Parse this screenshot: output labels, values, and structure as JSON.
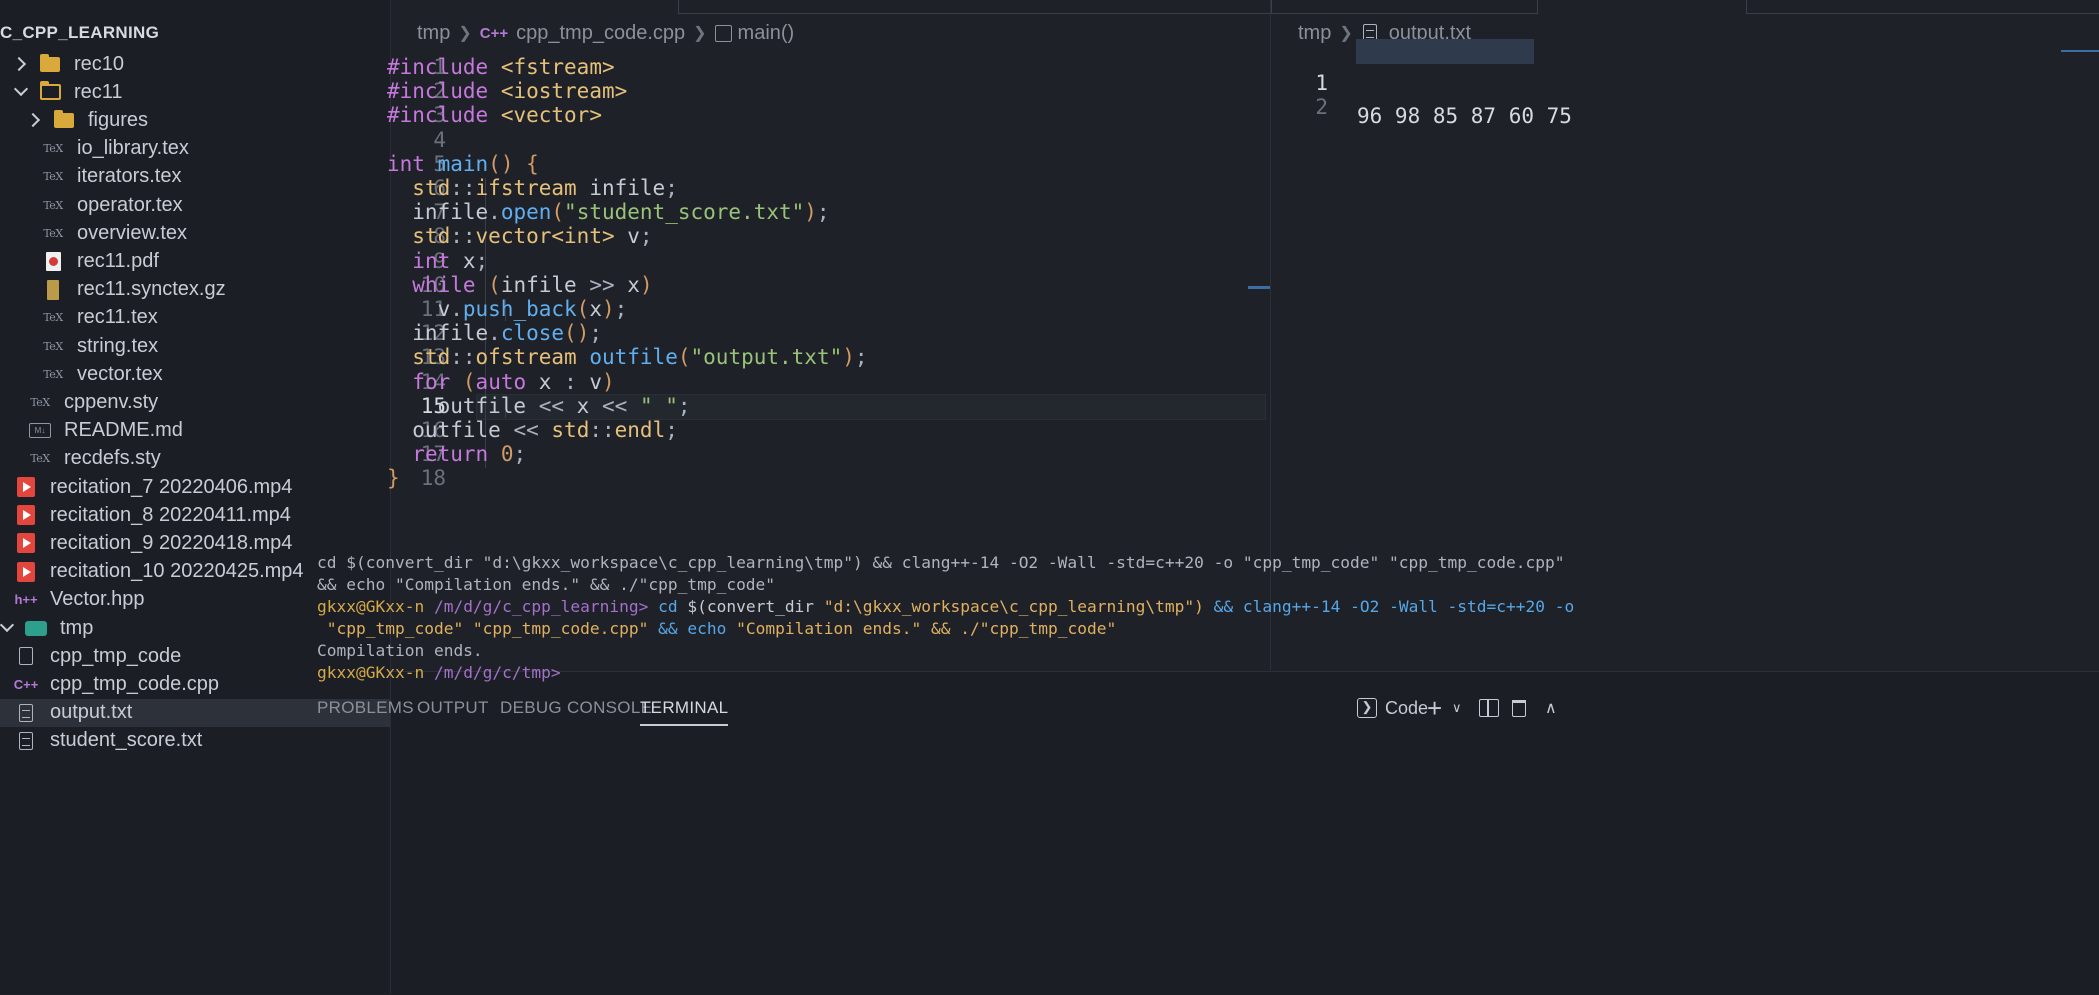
{
  "sidebar": {
    "root_label": "C_CPP_LEARNING",
    "items": [
      {
        "label": "rec10",
        "icon": "folder-icon"
      },
      {
        "label": "rec11",
        "icon": "folder-open-icon"
      },
      {
        "label": "figures",
        "icon": "folder-icon"
      },
      {
        "label": "io_library.tex",
        "icon": "tex-file-icon"
      },
      {
        "label": "iterators.tex",
        "icon": "tex-file-icon"
      },
      {
        "label": "operator.tex",
        "icon": "tex-file-icon"
      },
      {
        "label": "overview.tex",
        "icon": "tex-file-icon"
      },
      {
        "label": "rec11.pdf",
        "icon": "pdf-file-icon"
      },
      {
        "label": "rec11.synctex.gz",
        "icon": "archive-file-icon"
      },
      {
        "label": "rec11.tex",
        "icon": "tex-file-icon"
      },
      {
        "label": "string.tex",
        "icon": "tex-file-icon"
      },
      {
        "label": "vector.tex",
        "icon": "tex-file-icon"
      },
      {
        "label": "cppenv.sty",
        "icon": "tex-file-icon"
      },
      {
        "label": "README.md",
        "icon": "markdown-file-icon"
      },
      {
        "label": "recdefs.sty",
        "icon": "tex-file-icon"
      },
      {
        "label": "recitation_7 20220406.mp4",
        "icon": "video-file-icon"
      },
      {
        "label": "recitation_8 20220411.mp4",
        "icon": "video-file-icon"
      },
      {
        "label": "recitation_9 20220418.mp4",
        "icon": "video-file-icon"
      },
      {
        "label": "recitation_10 20220425.mp4",
        "icon": "video-file-icon"
      },
      {
        "label": "Vector.hpp",
        "icon": "hpp-file-icon"
      },
      {
        "label": "tmp",
        "icon": "folder-open-icon"
      },
      {
        "label": "cpp_tmp_code",
        "icon": "file-icon"
      },
      {
        "label": "cpp_tmp_code.cpp",
        "icon": "cpp-file-icon"
      },
      {
        "label": "output.txt",
        "icon": "text-file-icon"
      },
      {
        "label": "student_score.txt",
        "icon": "text-file-icon"
      }
    ],
    "active_item": "output.txt"
  },
  "editor": {
    "breadcrumb": [
      "tmp",
      "cpp_tmp_code.cpp",
      "main()"
    ],
    "line_numbers": [
      "1",
      "2",
      "3",
      "4",
      "5",
      "6",
      "7",
      "8",
      "9",
      "10",
      "11",
      "12",
      "13",
      "14",
      "15",
      "16",
      "17",
      "18"
    ],
    "current_line": "15",
    "code": [
      "#include <fstream>",
      "#include <iostream>",
      "#include <vector>",
      "",
      "int main() {",
      "  std::ifstream infile;",
      "  infile.open(\"student_score.txt\");",
      "  std::vector<int> v;",
      "  int x;",
      "  while (infile >> x)",
      "    v.push_back(x);",
      "  infile.close();",
      "  std::ofstream outfile(\"output.txt\");",
      "  for (auto x : v)",
      "    outfile << x << \" \";",
      "  outfile << std::endl;",
      "  return 0;",
      "}"
    ]
  },
  "output_editor": {
    "breadcrumb": [
      "tmp",
      "output.txt"
    ],
    "line_numbers": [
      "1",
      "2"
    ],
    "lines": [
      "96 98 85 87 60 75",
      ""
    ]
  },
  "panel": {
    "tabs": [
      "PROBLEMS",
      "OUTPUT",
      "DEBUG CONSOLE",
      "TERMINAL"
    ],
    "active_tab": "TERMINAL",
    "terminal_profile": "Code",
    "terminal": {
      "line1": "cd $(convert_dir \"d:\\gkxx_workspace\\c_cpp_learning\\tmp\") && clang++-14 -O2 -Wall -std=c++20 -o \"cpp_tmp_code\" \"cpp_tmp_code.cpp\"",
      "line2": "&& echo \"Compilation ends.\" && ./\"cpp_tmp_code\"",
      "prompt_user": "gkxx@GKxx-n",
      "prompt_path1": "/m/d/g/c_cpp_learning>",
      "cmd_cd": "cd",
      "cmd_convert": "$(convert_dir",
      "cmd_arg": "\"d:\\gkxx_workspace\\c_cpp_learning\\tmp\")",
      "cmd_rest": "&& clang++-14 -O2 -Wall -std=c++20 -o",
      "line4_a": " \"cpp_tmp_code\" \"cpp_tmp_code.cpp\"",
      "line4_b": "&& echo",
      "line4_c": "\"Compilation ends.\"",
      "line4_d": "&& ./\"cpp_tmp_code\"",
      "output1": "Compilation ends.",
      "prompt_path2": "/m/d/g/c/tmp>"
    }
  },
  "colors": {
    "keyword": "#c678dd",
    "type": "#e5c07b",
    "function": "#61afef",
    "string": "#98c379",
    "number": "#d19a66"
  }
}
